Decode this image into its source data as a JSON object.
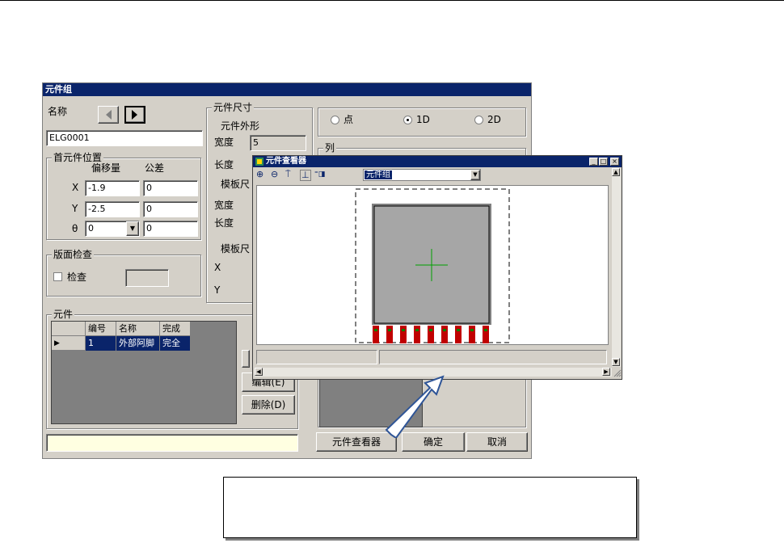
{
  "main_window": {
    "title": "元件组",
    "name_label": "名称",
    "name_value": "ELG0001",
    "first_pos": {
      "title": "首元件位置",
      "offset_header": "偏移量",
      "tol_header": "公差",
      "x_label": "X",
      "x_offset": "-1.9",
      "x_tol": "0",
      "y_label": "Y",
      "y_offset": "-2.5",
      "y_tol": "0",
      "t_label": "θ",
      "t_offset": "0",
      "t_tol": "0"
    },
    "board_check": {
      "title": "版面检查",
      "check_label": "检查",
      "checked": false
    },
    "elements": {
      "title": "元件",
      "columns": [
        "编号",
        "名称",
        "完成"
      ],
      "rows": [
        {
          "no": "1",
          "name": "外部阿脚",
          "done": "完全"
        }
      ]
    },
    "size": {
      "title": "元件尺寸",
      "shape_label": "元件外形",
      "width_label": "宽度",
      "width_value": "5",
      "length_label": "长度",
      "template_label1": "模板尺",
      "width2_label": "宽度",
      "length2_label": "长度",
      "template_label2": "模板尺",
      "x_label": "X",
      "y_label": "Y"
    },
    "mode": {
      "point": "点",
      "one_d": "1D",
      "two_d": "2D",
      "selected": "1D"
    },
    "row_group_title": "列",
    "buttons": {
      "edit": "编辑(E)",
      "delete": "删除(D)",
      "viewer": "元件查看器",
      "ok": "确定",
      "cancel": "取消"
    }
  },
  "viewer_window": {
    "title": "元件查看器",
    "combo_value": "元件组",
    "tools": [
      "⊕",
      "⊖",
      "⍑",
      "⊥",
      "⁼◨"
    ],
    "min_icon": "_",
    "max_icon": "□",
    "close_icon": "×"
  },
  "colors": {
    "title_bar": "#0a246a",
    "window_bg": "#d4d0c8",
    "pad_red": "#c00000",
    "pad_green": "#008000",
    "crosshair": "#00a000",
    "arrow": "#2f5597"
  }
}
